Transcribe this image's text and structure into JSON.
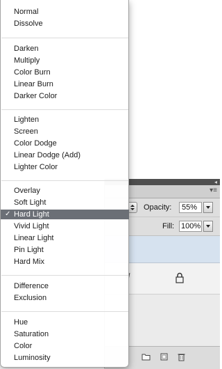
{
  "blend_menu": {
    "groups": [
      [
        "Normal",
        "Dissolve"
      ],
      [
        "Darken",
        "Multiply",
        "Color Burn",
        "Linear Burn",
        "Darker Color"
      ],
      [
        "Lighten",
        "Screen",
        "Color Dodge",
        "Linear Dodge (Add)",
        "Lighter Color"
      ],
      [
        "Overlay",
        "Soft Light",
        "Hard Light",
        "Vivid Light",
        "Linear Light",
        "Pin Light",
        "Hard Mix"
      ],
      [
        "Difference",
        "Exclusion"
      ],
      [
        "Hue",
        "Saturation",
        "Color",
        "Luminosity"
      ]
    ],
    "selected": "Hard Light",
    "check_mark": "✓"
  },
  "layers_panel": {
    "opacity_label": "Opacity:",
    "opacity_value": "55%",
    "fill_label": "Fill:",
    "fill_value": "100%",
    "layer_name_fragment": "d",
    "colors": {
      "selected_row": "#d6e2ef",
      "menu_highlight": "#6b6f76"
    }
  }
}
